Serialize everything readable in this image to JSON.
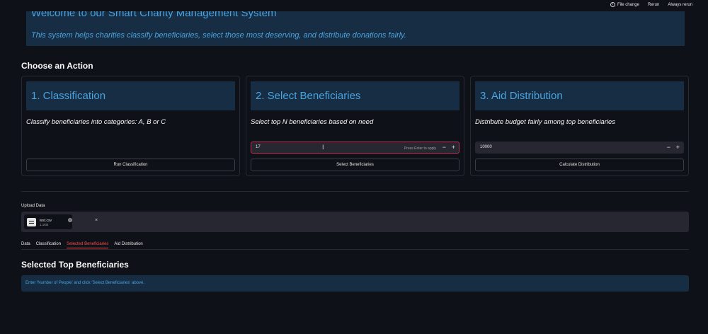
{
  "topbar": {
    "file_change": "File change",
    "rerun": "Rerun",
    "always_rerun": "Always rerun"
  },
  "welcome": {
    "title": "Welcome to our Smart Charity Management System",
    "subtitle": "This system helps charities classify beneficiaries, select those most deserving, and distribute donations fairly."
  },
  "choose_action": "Choose an Action",
  "cards": [
    {
      "title": "1. Classification",
      "description": "Classify beneficiaries into categories: A, B or C",
      "button": "Run Classification"
    },
    {
      "title": "2. Select Beneficiaries",
      "description": "Select top N beneficiaries based on need",
      "input_value": "17",
      "input_hint": "Press Enter to apply",
      "button": "Select Beneficiaries"
    },
    {
      "title": "3. Aid Distribution",
      "description": "Distribute budget fairly among top beneficiaries",
      "input_value": "10000",
      "button": "Calculate Distribution"
    }
  ],
  "upload": {
    "label": "Upload Data",
    "file_name": "test.csv",
    "file_size": "1.1KB"
  },
  "tabs": [
    "Data",
    "Classification",
    "Selected Beneficiaries",
    "Aid Distribution"
  ],
  "active_tab": "Selected Beneficiaries",
  "selected_title": "Selected Top Beneficiaries",
  "info_message": "Enter 'Number of People' and click 'Select Beneficiaries' above.",
  "colors": {
    "background": "#0e1117",
    "banner": "#172d43",
    "accent_text": "#4aa3df",
    "active_tab": "#ff4b4b",
    "input": "#262730"
  }
}
